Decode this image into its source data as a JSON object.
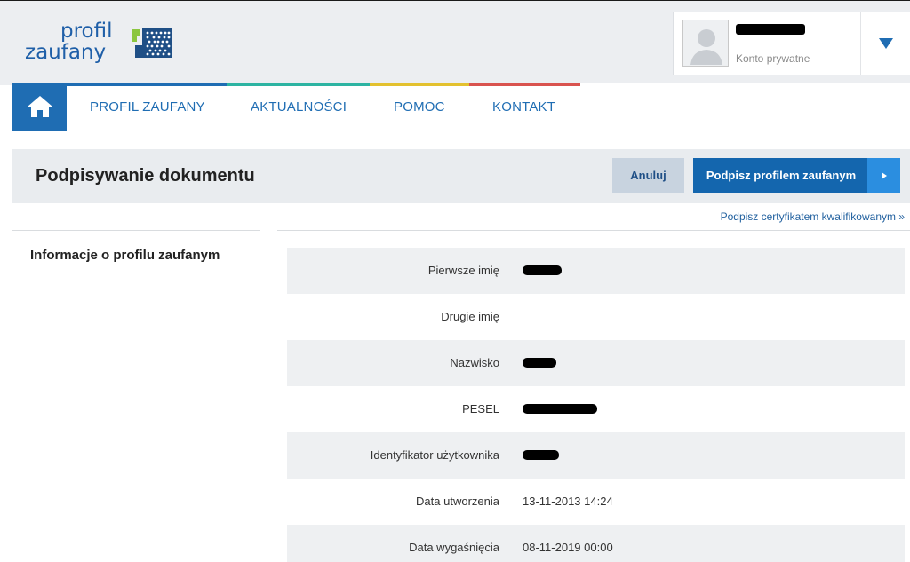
{
  "header": {
    "logo_line1": "profil",
    "logo_line2": "zaufany",
    "user": {
      "account_type": "Konto prywatne"
    }
  },
  "nav": {
    "items": [
      {
        "label": "PROFIL ZAUFANY"
      },
      {
        "label": "AKTUALNOŚCI"
      },
      {
        "label": "POMOC"
      },
      {
        "label": "KONTAKT"
      }
    ],
    "strip_colors": [
      "#1f6db3",
      "#2db4a2",
      "#e3c12f",
      "#d9534f"
    ]
  },
  "page": {
    "title": "Podpisywanie dokumentu",
    "cancel_label": "Anuluj",
    "sign_label": "Podpisz profilem zaufanym",
    "cert_link": "Podpisz certyfikatem kwalifikowanym »"
  },
  "profile_info": {
    "title": "Informacje o profilu zaufanym",
    "rows": [
      {
        "label": "Pierwsze imię",
        "value": "",
        "redacted": true
      },
      {
        "label": "Drugie imię",
        "value": "",
        "redacted": false
      },
      {
        "label": "Nazwisko",
        "value": "",
        "redacted": true
      },
      {
        "label": "PESEL",
        "value": "",
        "redacted": true
      },
      {
        "label": "Identyfikator użytkownika",
        "value": "",
        "redacted": true
      },
      {
        "label": "Data utworzenia",
        "value": "13-11-2013 14:24",
        "redacted": false
      },
      {
        "label": "Data wygaśnięcia",
        "value": "08-11-2019 00:00",
        "redacted": false
      }
    ]
  },
  "colors": {
    "primary": "#1466ae",
    "accent": "#2b8ee0",
    "logo_green": "#8cc63f"
  }
}
